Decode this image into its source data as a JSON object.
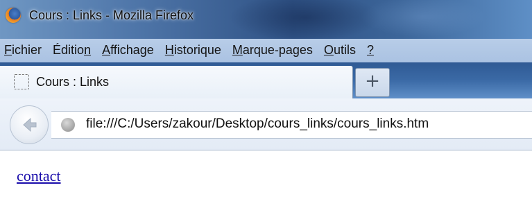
{
  "window": {
    "title": "Cours : Links - Mozilla Firefox",
    "app_icon": "firefox-logo"
  },
  "menu": [
    {
      "key": "F",
      "rest": "ichier"
    },
    {
      "key": "É",
      "rest": "dition"
    },
    {
      "key": "A",
      "rest": "ffichage"
    },
    {
      "key": "H",
      "rest": "istorique"
    },
    {
      "key": "M",
      "rest": "arque-pages"
    },
    {
      "key": "O",
      "rest": "utils"
    },
    {
      "key": "?",
      "rest": ""
    }
  ],
  "tabs": {
    "active_title": "Cours : Links",
    "new_tab_symbol": "+"
  },
  "navigation": {
    "url": "file:///C:/Users/zakour/Desktop/cours_links/cours_links.htm",
    "back_icon": "back-arrow-icon",
    "site_icon": "globe-icon"
  },
  "page": {
    "link_text": "contact",
    "link_color": "#1a0dab"
  }
}
